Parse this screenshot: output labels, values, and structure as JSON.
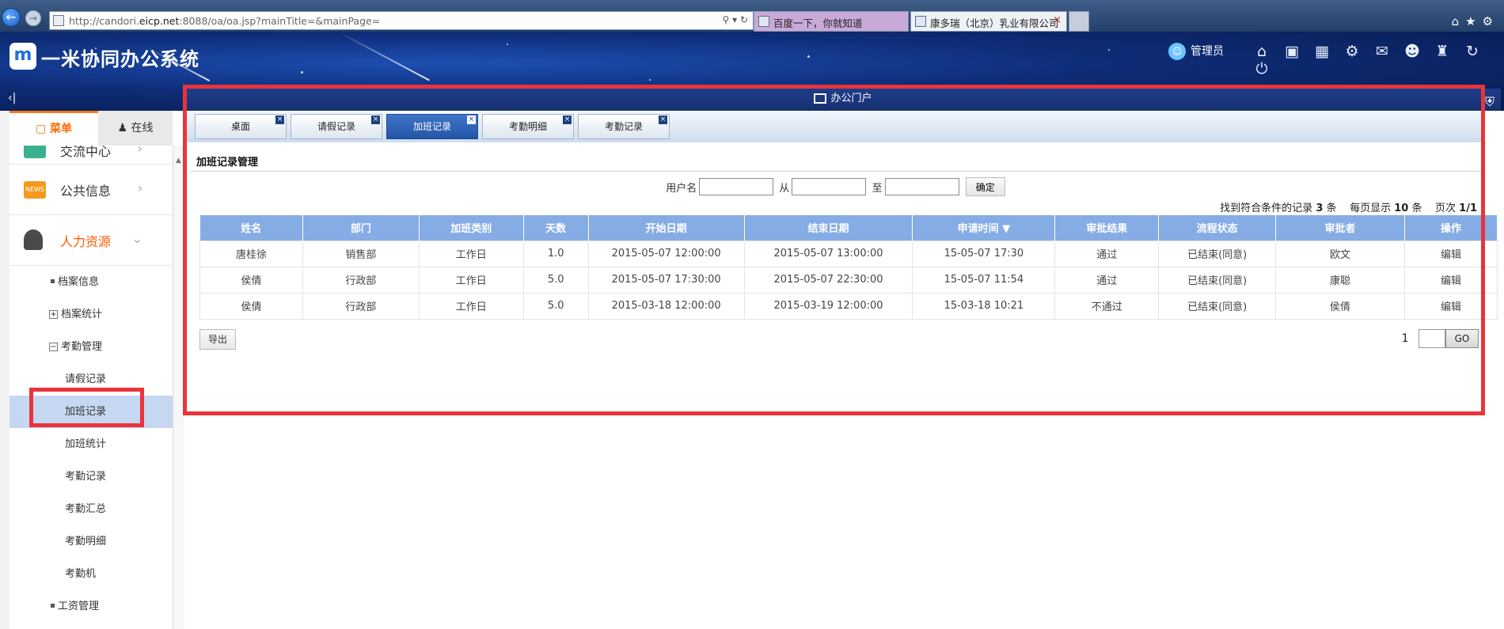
{
  "browser": {
    "url_prefix": "http://candori.",
    "url_host": "eicp.net",
    "url_rest": ":8088/oa/oa.jsp?mainTitle=&mainPage=",
    "tabs": [
      {
        "label": "百度一下，你就知道"
      },
      {
        "label": "康多瑞（北京）乳业有限公司"
      }
    ]
  },
  "header": {
    "logo": "m",
    "title": "一米协同办公系统",
    "user": "管理员",
    "icons": [
      "home-icon",
      "camera-icon",
      "calendar-icon",
      "gear-icon",
      "mail-icon",
      "user-circle-icon",
      "shirt-icon",
      "refresh-icon",
      "power-icon"
    ]
  },
  "portal": {
    "title": "办公门户"
  },
  "sidebar": {
    "tabs": {
      "menu": "菜单",
      "online": "在线"
    },
    "top_item": "交流中心",
    "items": [
      {
        "label": "公共信息",
        "badge": "NEWS"
      },
      {
        "label": "人力资源"
      }
    ],
    "sub_items": [
      {
        "label": "档案信息",
        "type": "bullet"
      },
      {
        "label": "档案统计",
        "type": "plus"
      },
      {
        "label": "考勤管理",
        "type": "minus"
      },
      {
        "label": "请假记录",
        "type": "leaf"
      },
      {
        "label": "加班记录",
        "type": "leaf",
        "active": true
      },
      {
        "label": "加班统计",
        "type": "leaf"
      },
      {
        "label": "考勤记录",
        "type": "leaf"
      },
      {
        "label": "考勤汇总",
        "type": "leaf"
      },
      {
        "label": "考勤明细",
        "type": "leaf"
      },
      {
        "label": "考勤机",
        "type": "leaf"
      },
      {
        "label": "工资管理",
        "type": "bullet"
      }
    ]
  },
  "content_tabs": [
    {
      "label": "桌面"
    },
    {
      "label": "请假记录"
    },
    {
      "label": "加班记录",
      "active": true
    },
    {
      "label": "考勤明细"
    },
    {
      "label": "考勤记录"
    }
  ],
  "main": {
    "section_title": "加班记录管理",
    "search": {
      "user_label": "用户名",
      "from_label": "从",
      "to_label": "至",
      "confirm": "确定"
    },
    "record_info": {
      "prefix": "找到符合条件的记录",
      "count": "3",
      "unit1": "条",
      "per_page_label": "每页显示",
      "per_page": "10",
      "unit2": "条",
      "page_label": "页次",
      "page": "1/1"
    },
    "columns": [
      "姓名",
      "部门",
      "加班类别",
      "天数",
      "开始日期",
      "结束日期",
      "申请时间 ▼",
      "审批结果",
      "流程状态",
      "审批者",
      "操作"
    ],
    "rows": [
      [
        "唐桂徐",
        "销售部",
        "工作日",
        "1.0",
        "2015-05-07 12:00:00",
        "2015-05-07 13:00:00",
        "15-05-07 17:30",
        "通过",
        "已结束(同意)",
        "欧文",
        "编辑"
      ],
      [
        "侯倩",
        "行政部",
        "工作日",
        "5.0",
        "2015-05-07 17:30:00",
        "2015-05-07 22:30:00",
        "15-05-07 11:54",
        "通过",
        "已结束(同意)",
        "康聪",
        "编辑"
      ],
      [
        "侯倩",
        "行政部",
        "工作日",
        "5.0",
        "2015-03-18 12:00:00",
        "2015-03-19 12:00:00",
        "15-03-18 10:21",
        "不通过",
        "已结束(同意)",
        "侯倩",
        "编辑"
      ]
    ],
    "export": "导出",
    "pager": {
      "page": "1",
      "go": "GO"
    }
  }
}
